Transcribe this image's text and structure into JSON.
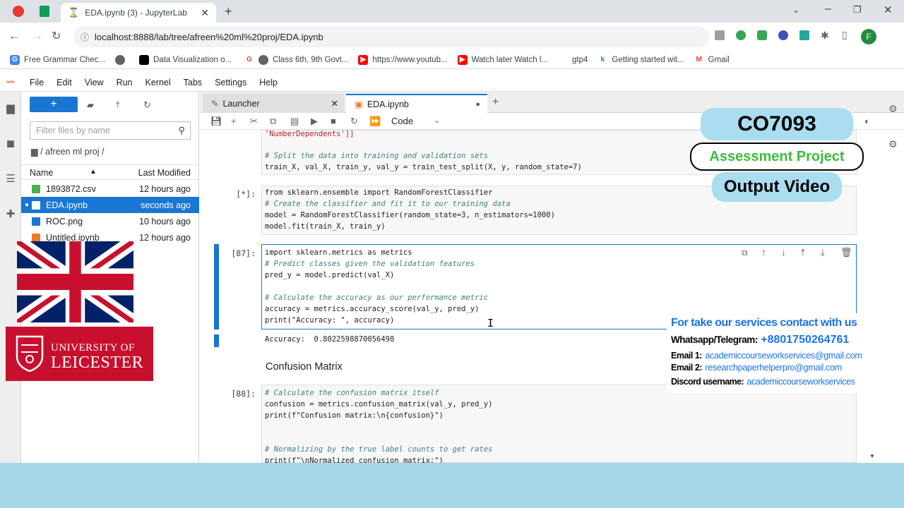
{
  "browser": {
    "tab_title": "EDA.ipynb (3) - JupyterLab",
    "url": "localhost:8888/lab/tree/afreen%20ml%20proj/EDA.ipynb",
    "profile_initial": "F",
    "bookmarks": [
      {
        "label": "Free Grammar Chec...",
        "color": "#4285f4"
      },
      {
        "label": "",
        "color": "#5f6368"
      },
      {
        "label": "Data Visualization o...",
        "color": "#000000"
      },
      {
        "label": "Class 6th, 9th Govt...",
        "color": "#4285f4"
      },
      {
        "label": "https://www.youtub...",
        "color": "#ff0000"
      },
      {
        "label": "Watch later Watch l...",
        "color": "#ff0000"
      },
      {
        "label": "gtp4",
        "color": "#ffffff"
      },
      {
        "label": "Getting started wit...",
        "color": "#0f7ed9"
      },
      {
        "label": "Gmail",
        "color": "#ea4335"
      }
    ]
  },
  "menu": [
    "File",
    "Edit",
    "View",
    "Run",
    "Kernel",
    "Tabs",
    "Settings",
    "Help"
  ],
  "filebrowser": {
    "filter_placeholder": "Filter files by name",
    "breadcrumb": "/ afreen ml proj /",
    "col_name": "Name",
    "col_modified": "Last Modified",
    "files": [
      {
        "name": "1893872.csv",
        "modified": "12 hours ago",
        "selected": false,
        "color": "#4caf50"
      },
      {
        "name": "EDA.ipynb",
        "modified": "seconds ago",
        "selected": true,
        "color": "#f37726"
      },
      {
        "name": "ROC.png",
        "modified": "10 hours ago",
        "selected": false,
        "color": "#1976d2"
      },
      {
        "name": "Untitled.ipynb",
        "modified": "12 hours ago",
        "selected": false,
        "color": "#f37726"
      }
    ]
  },
  "university": {
    "line1": "UNIVERSITY OF",
    "line2": "LEICESTER"
  },
  "notebook": {
    "tabs": [
      {
        "label": "Launcher"
      },
      {
        "label": "EDA.ipynb"
      }
    ],
    "cell_type": "Code",
    "cells": {
      "top_fragment": "'NumberDependents']]",
      "split_comment": "# Split the data into training and validation sets",
      "split_code": "train_X, val_X, train_y, val_y = train_test_split(X, y, random_state=7)",
      "rf_prompt": "[*]:",
      "rf_lines": [
        "from sklearn.ensemble import RandomForestClassifier",
        "# Create the classifier and fit it to our training data",
        "model = RandomForestClassifier(random_state=3, n_estimators=1000)",
        "model.fit(train_X, train_y)"
      ],
      "acc_prompt": "[87]:",
      "acc_lines": [
        "import sklearn.metrics as metrics",
        "# Predict classes given the validation features",
        "pred_y = model.predict(val_X)",
        "",
        "# Calculate the accuracy as our performance metric",
        "accuracy = metrics.accuracy_score(val_y, pred_y)",
        "print(\"Accuracy: \", accuracy)"
      ],
      "acc_output": "Accuracy:  0.8022598870056498",
      "heading": "Confusion Matrix",
      "cm_prompt": "[88]:",
      "cm_lines": [
        "# Calculate the confusion matrix itself",
        "confusion = metrics.confusion_matrix(val_y, pred_y)",
        "print(f\"Confusion matrix:\\n{confusion}\")",
        "",
        "",
        "# Normalizing by the true label counts to get rates",
        "print(f\"\\nNormalized confusion matrix:\")"
      ]
    }
  },
  "overlay": {
    "course_code": "CO7093",
    "assessment": "Assessment Project",
    "output": "Output Video",
    "contact_title": "For take our services contact with us",
    "whatsapp_label": "Whatsapp/Telegram:",
    "whatsapp_value": "+8801750264761",
    "email1_label": "Email 1:",
    "email1_value": "academiccourseworkservices@gmail.com",
    "email2_label": "Email 2:",
    "email2_value": "researchpaperhelperpro@gmail.com",
    "discord_label": "Discord username:",
    "discord_value": "academiccourseworkservices"
  }
}
